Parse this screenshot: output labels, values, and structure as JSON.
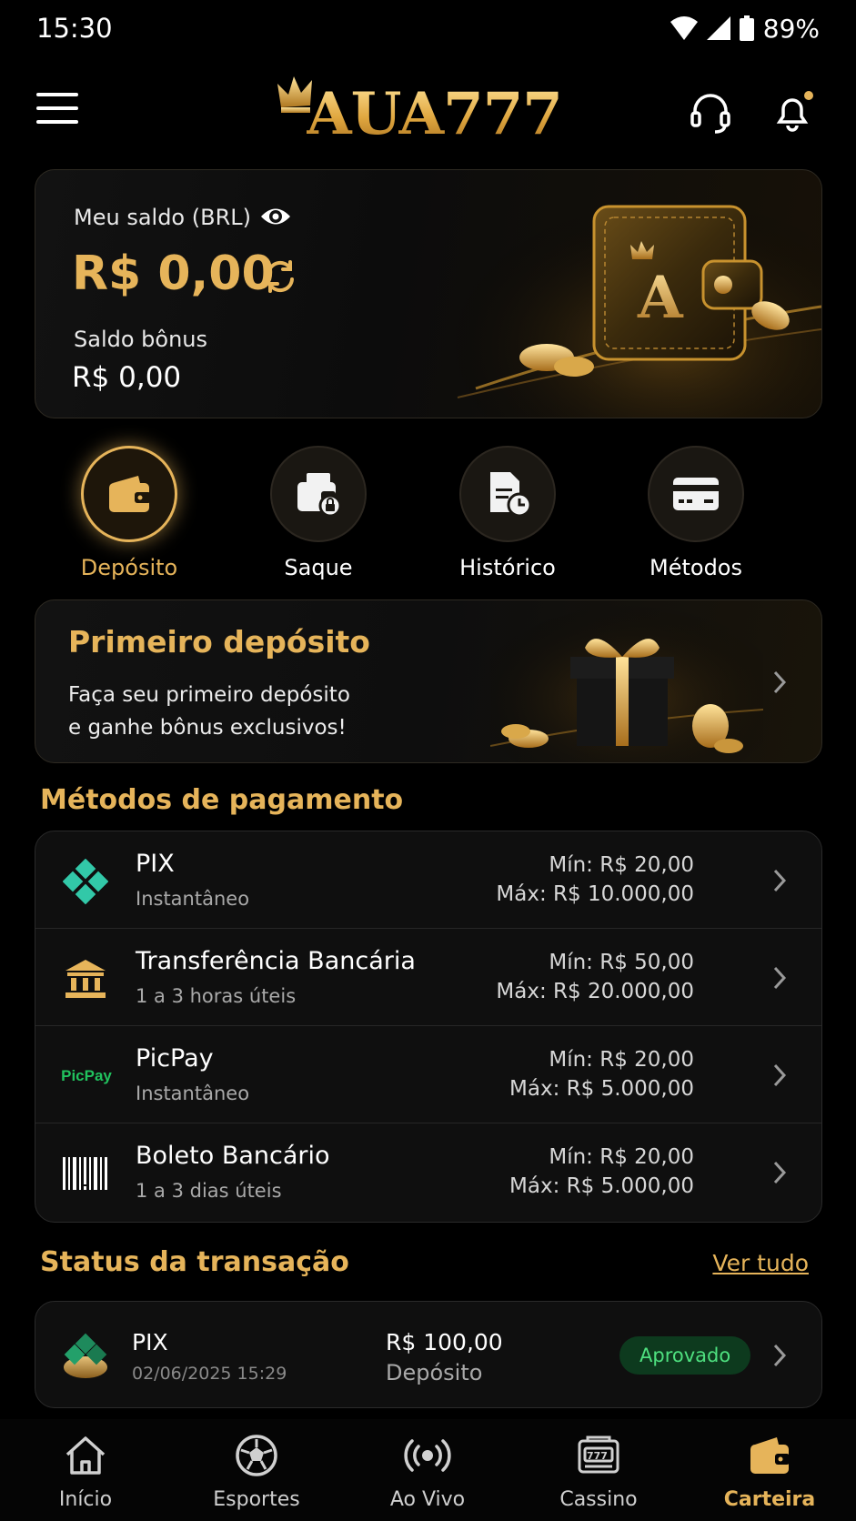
{
  "status_bar": {
    "time": "15:30",
    "battery": "89%"
  },
  "header": {
    "logo": "AUA777"
  },
  "balance": {
    "label": "Meu saldo (BRL)",
    "amount": "R$ 0,00",
    "bonus_label": "Saldo bônus",
    "bonus_amount": "R$ 0,00"
  },
  "actions": [
    {
      "label": "Depósito",
      "icon": "wallet-icon",
      "active": true
    },
    {
      "label": "Saque",
      "icon": "withdraw-icon",
      "active": false
    },
    {
      "label": "Histórico",
      "icon": "history-icon",
      "active": false
    },
    {
      "label": "Métodos",
      "icon": "card-icon",
      "active": false
    }
  ],
  "promo": {
    "title": "Primeiro depósito",
    "text_line1": "Faça seu primeiro depósito",
    "text_line2": "e ganhe bônus exclusivos!"
  },
  "payment_methods": {
    "title": "Métodos de pagamento",
    "items": [
      {
        "name": "PIX",
        "sub": "Instantâneo",
        "min": "Mín: R$ 20,00",
        "max": "Máx: R$ 10.000,00",
        "icon": "pix-icon"
      },
      {
        "name": "Transferência Bancária",
        "sub": "1 a 3 horas úteis",
        "min": "Mín: R$ 50,00",
        "max": "Máx: R$ 20.000,00",
        "icon": "bank-icon"
      },
      {
        "name": "PicPay",
        "sub": "Instantâneo",
        "min": "Mín: R$ 20,00",
        "max": "Máx: R$ 5.000,00",
        "icon": "picpay-icon",
        "icon_text": "PicPay"
      },
      {
        "name": "Boleto Bancário",
        "sub": "1 a 3 dias úteis",
        "min": "Mín: R$ 20,00",
        "max": "Máx: R$ 5.000,00",
        "icon": "barcode-icon"
      }
    ]
  },
  "transactions": {
    "title": "Status da transação",
    "see_all": "Ver tudo",
    "items": [
      {
        "method": "PIX",
        "date": "02/06/2025 15:29",
        "amount": "R$ 100,00",
        "type": "Depósito",
        "status": "Aprovado"
      }
    ]
  },
  "bottom_nav": [
    {
      "label": "Início",
      "icon": "home-icon",
      "active": false
    },
    {
      "label": "Esportes",
      "icon": "soccer-ball-icon",
      "active": false
    },
    {
      "label": "Ao Vivo",
      "icon": "live-broadcast-icon",
      "active": false
    },
    {
      "label": "Cassino",
      "icon": "slot-machine-icon",
      "active": false
    },
    {
      "label": "Carteira",
      "icon": "wallet-icon",
      "active": true
    }
  ],
  "colors": {
    "accent": "#e6b45a",
    "background": "#000000",
    "approved": "#4ee07f"
  }
}
